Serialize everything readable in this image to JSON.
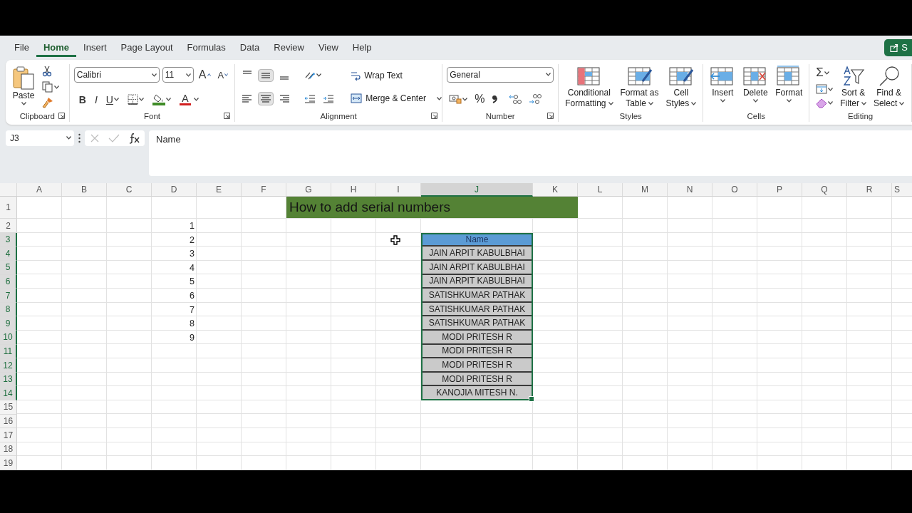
{
  "menu_tabs": [
    {
      "label": "File",
      "selected": false
    },
    {
      "label": "Home",
      "selected": true
    },
    {
      "label": "Insert",
      "selected": false
    },
    {
      "label": "Page Layout",
      "selected": false
    },
    {
      "label": "Formulas",
      "selected": false
    },
    {
      "label": "Data",
      "selected": false
    },
    {
      "label": "Review",
      "selected": false
    },
    {
      "label": "View",
      "selected": false
    },
    {
      "label": "Help",
      "selected": false
    }
  ],
  "share_button": {
    "label": "S"
  },
  "ribbon": {
    "clipboard": {
      "label": "Clipboard",
      "paste": "Paste"
    },
    "font": {
      "label": "Font",
      "font_name": "Calibri",
      "font_size": "11",
      "grow": "A",
      "shrink": "A",
      "bold": "B",
      "italic": "I",
      "underline": "U",
      "font_color": "A"
    },
    "alignment": {
      "label": "Alignment",
      "buttons": [
        {
          "kind": "top",
          "pressed": false
        },
        {
          "kind": "middle",
          "pressed": true
        },
        {
          "kind": "bottom",
          "pressed": false
        },
        {
          "kind": "left",
          "pressed": false
        },
        {
          "kind": "center",
          "pressed": true
        },
        {
          "kind": "right",
          "pressed": false
        }
      ],
      "wrap_text": "Wrap Text",
      "merge": "Merge & Center"
    },
    "number": {
      "label": "Number",
      "format": "General",
      "percent": "%"
    },
    "styles": {
      "label": "Styles",
      "buttons": [
        {
          "kind": "conditional",
          "lines": [
            "Conditional",
            "Formatting"
          ]
        },
        {
          "kind": "table",
          "lines": [
            "Format as",
            "Table"
          ]
        },
        {
          "kind": "cellstyles",
          "lines": [
            "Cell",
            "Styles"
          ]
        }
      ]
    },
    "cells": {
      "label": "Cells",
      "buttons": [
        {
          "kind": "insert",
          "label": "Insert"
        },
        {
          "kind": "delete",
          "label": "Delete"
        },
        {
          "kind": "format",
          "label": "Format"
        }
      ]
    },
    "editing": {
      "label": "Editing",
      "sum": "Σ",
      "buttons": [
        {
          "kind": "sort",
          "lines": [
            "Sort &",
            "Filter"
          ]
        },
        {
          "kind": "find",
          "lines": [
            "Find &",
            "Select"
          ]
        }
      ]
    }
  },
  "formula_bar": {
    "name_box": "J3",
    "content": "Name"
  },
  "sheet": {
    "columns": [
      {
        "label": "A",
        "selected": false
      },
      {
        "label": "B",
        "selected": false
      },
      {
        "label": "C",
        "selected": false
      },
      {
        "label": "D",
        "selected": false
      },
      {
        "label": "E",
        "selected": false
      },
      {
        "label": "F",
        "selected": false
      },
      {
        "label": "G",
        "selected": false
      },
      {
        "label": "H",
        "selected": false
      },
      {
        "label": "I",
        "selected": false
      },
      {
        "label": "J",
        "selected": true
      },
      {
        "label": "K",
        "selected": false
      },
      {
        "label": "L",
        "selected": false
      },
      {
        "label": "M",
        "selected": false
      },
      {
        "label": "N",
        "selected": false
      },
      {
        "label": "O",
        "selected": false
      },
      {
        "label": "P",
        "selected": false
      },
      {
        "label": "Q",
        "selected": false
      },
      {
        "label": "R",
        "selected": false
      },
      {
        "label": "S",
        "selected": false
      }
    ],
    "rows": [
      {
        "number": "1",
        "selected": false,
        "title": "How to add serial numbers"
      },
      {
        "number": "2",
        "selected": false,
        "serial": "1"
      },
      {
        "number": "3",
        "selected": true,
        "serial": "2",
        "name": "Name",
        "header": true
      },
      {
        "number": "4",
        "selected": true,
        "serial": "3",
        "name": "JAIN  ARPIT  KABULBHAI",
        "header": false
      },
      {
        "number": "5",
        "selected": true,
        "serial": "4",
        "name": "JAIN  ARPIT  KABULBHAI",
        "header": false
      },
      {
        "number": "6",
        "selected": true,
        "serial": "5",
        "name": "JAIN  ARPIT  KABULBHAI",
        "header": false
      },
      {
        "number": "7",
        "selected": true,
        "serial": "6",
        "name": "SATISHKUMAR PATHAK",
        "header": false
      },
      {
        "number": "8",
        "selected": true,
        "serial": "7",
        "name": "SATISHKUMAR PATHAK",
        "header": false
      },
      {
        "number": "9",
        "selected": true,
        "serial": "8",
        "name": "SATISHKUMAR PATHAK",
        "header": false
      },
      {
        "number": "10",
        "selected": true,
        "serial": "9",
        "name": "MODI PRITESH R",
        "header": false
      },
      {
        "number": "11",
        "selected": true,
        "name": "MODI PRITESH R",
        "header": false
      },
      {
        "number": "12",
        "selected": true,
        "name": "MODI PRITESH R",
        "header": false
      },
      {
        "number": "13",
        "selected": true,
        "name": "MODI PRITESH R",
        "header": false
      },
      {
        "number": "14",
        "selected": true,
        "name": "KANOJIA MITESH N.",
        "header": false
      },
      {
        "number": "15",
        "selected": false
      },
      {
        "number": "16",
        "selected": false
      },
      {
        "number": "17",
        "selected": false
      },
      {
        "number": "18",
        "selected": false
      },
      {
        "number": "19",
        "selected": false
      }
    ]
  }
}
